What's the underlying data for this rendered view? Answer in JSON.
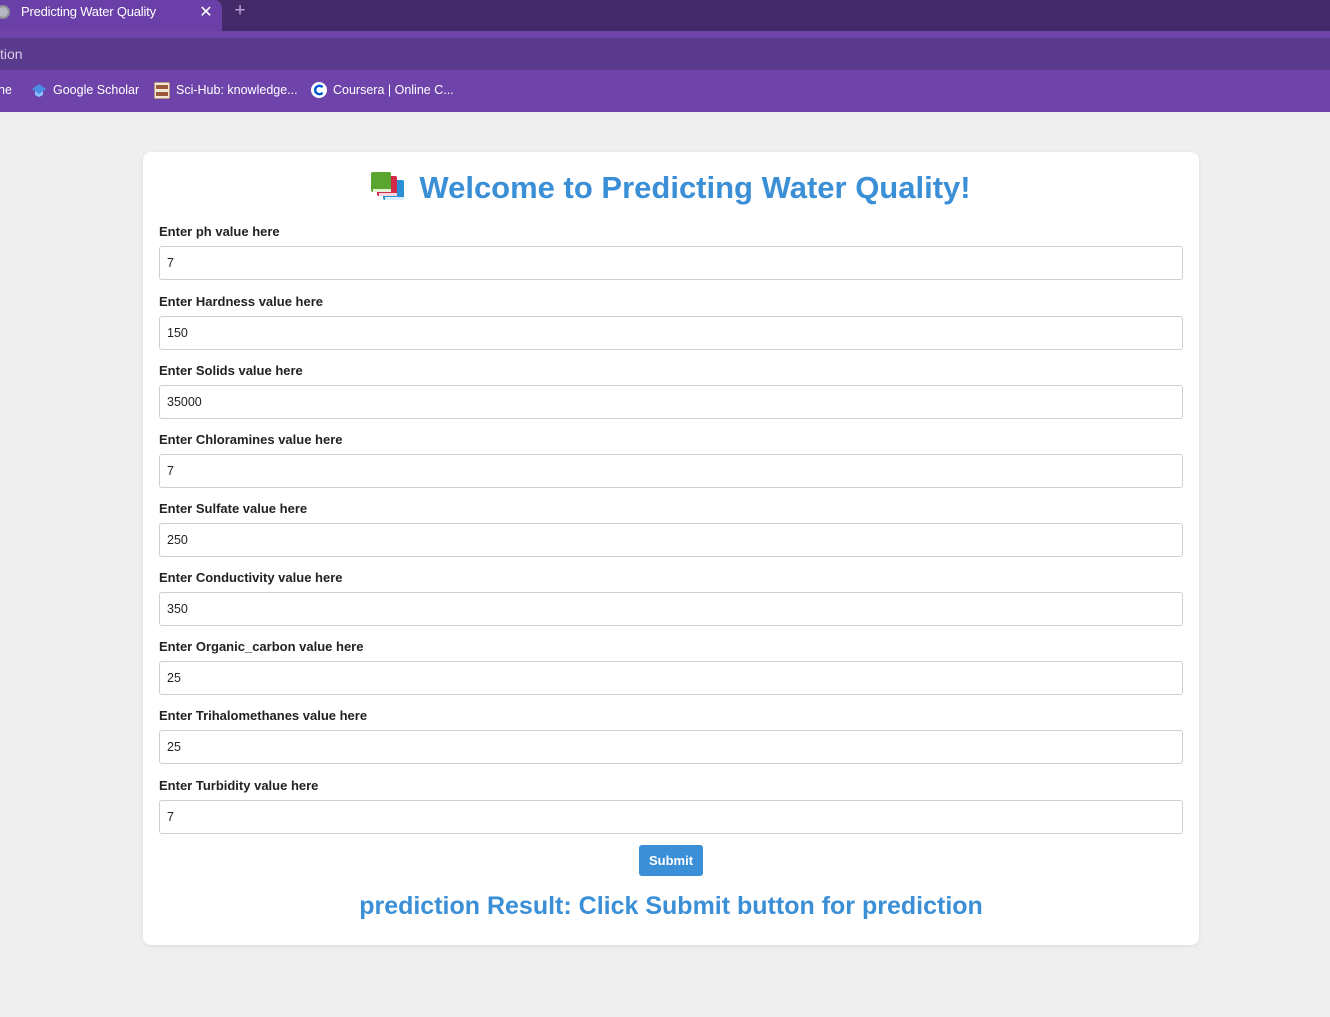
{
  "browser": {
    "tab_title": "Predicting Water Quality",
    "tab_close": "✕",
    "new_tab": "+",
    "address_fragment": "tion",
    "bookmarks": [
      {
        "label": "ne",
        "icon": "none"
      },
      {
        "label": "Google Scholar",
        "icon": "graduation-cap-icon"
      },
      {
        "label": "Sci-Hub: knowledge...",
        "icon": "scihub-logo-icon"
      },
      {
        "label": "Coursera | Online C...",
        "icon": "coursera-logo-icon"
      }
    ]
  },
  "page": {
    "title": "Welcome to Predicting Water Quality!",
    "title_icon": "books-icon",
    "fields": [
      {
        "label": "Enter ph value here",
        "value": "7"
      },
      {
        "label": "Enter Hardness value here",
        "value": "150"
      },
      {
        "label": "Enter Solids value here",
        "value": "35000"
      },
      {
        "label": "Enter Chloramines value here",
        "value": "7"
      },
      {
        "label": "Enter Sulfate value here",
        "value": "250"
      },
      {
        "label": "Enter Conductivity value here",
        "value": "350"
      },
      {
        "label": "Enter Organic_carbon value here",
        "value": "25"
      },
      {
        "label": "Enter Trihalomethanes value here",
        "value": "25"
      },
      {
        "label": "Enter Turbidity value here",
        "value": "7"
      }
    ],
    "submit_label": "Submit",
    "result_prefix": "prediction Result: ",
    "result_value": "Click Submit button for prediction"
  },
  "colors": {
    "accent": "#3a8fd6",
    "chrome_dark": "#452a6a",
    "chrome_purple": "#6e44ab",
    "background": "#efefef"
  }
}
